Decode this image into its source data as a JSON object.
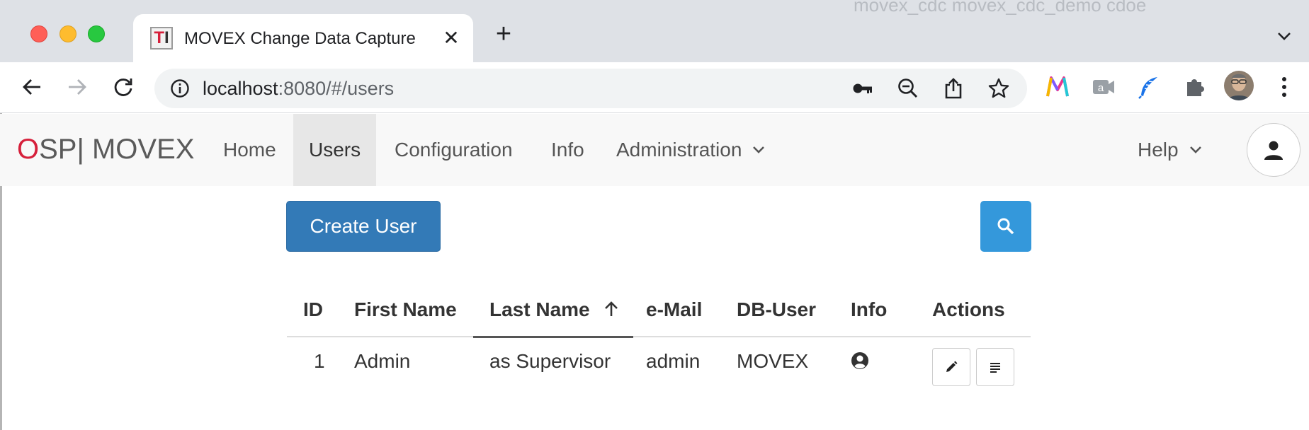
{
  "browser": {
    "background_ghost_text": "movex_cdc    movex_cdc_demo cdoe",
    "tab": {
      "favicon_letters": "TI",
      "title": "MOVEX Change Data Capture",
      "close_symbol": "✕"
    },
    "new_tab_symbol": "+",
    "address": {
      "host": "localhost",
      "rest": ":8080/#/users"
    },
    "icons": [
      "back-icon",
      "forward-icon",
      "reload-icon",
      "info-icon",
      "key-icon",
      "zoom-out-icon",
      "share-icon",
      "star-icon",
      "extension-m-icon",
      "extension-a-icon",
      "extension-feather-icon",
      "puzzle-icon",
      "profile-avatar-icon",
      "kebab-menu-icon",
      "tab-dropdown-icon"
    ]
  },
  "app": {
    "brand": {
      "o": "O",
      "sp": "SP",
      "sep": "|",
      "movex": " MOVEX"
    },
    "nav": {
      "home": "Home",
      "users": "Users",
      "configuration": "Configuration",
      "info": "Info",
      "administration": "Administration",
      "help": "Help"
    },
    "colors": {
      "brand_red": "#d6203b",
      "primary": "#337ab7",
      "search": "#3498db"
    }
  },
  "main": {
    "create_user_label": "Create User",
    "table": {
      "headers": {
        "id": "ID",
        "first_name": "First Name",
        "last_name": "Last Name",
        "email": "e-Mail",
        "db_user": "DB-User",
        "info": "Info",
        "actions": "Actions"
      },
      "sorted_by": "Last Name",
      "sort_direction": "ascending",
      "rows": [
        {
          "id": "1",
          "first_name": "Admin",
          "last_name": "as Supervisor",
          "email": "admin",
          "db_user": "MOVEX",
          "info_icon": "user-circle-icon",
          "action_icons": [
            "edit-icon",
            "details-icon"
          ]
        }
      ]
    }
  }
}
